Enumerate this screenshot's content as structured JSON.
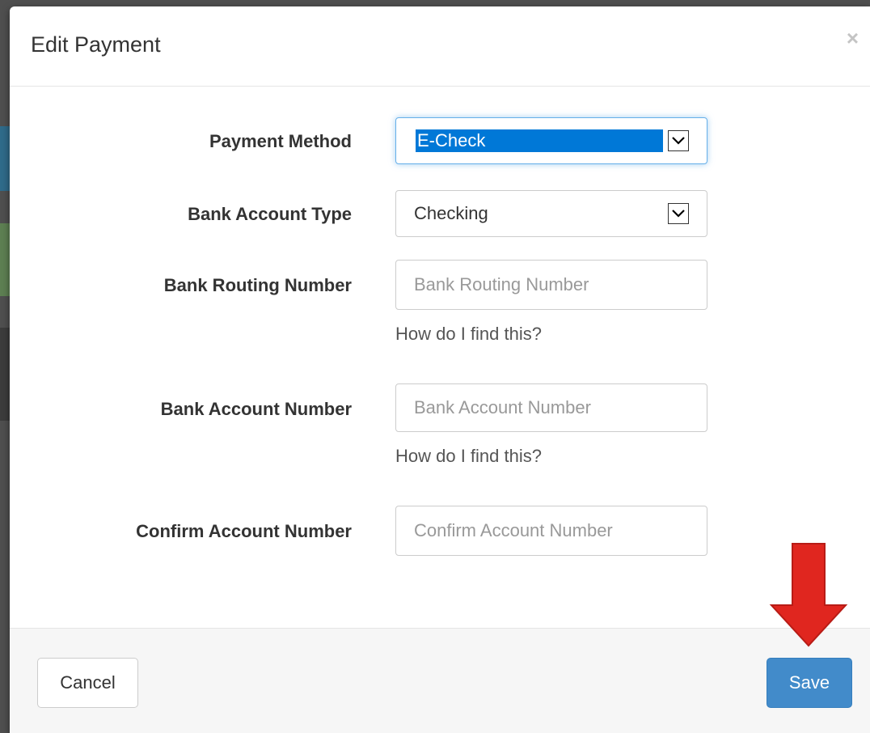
{
  "modal": {
    "title": "Edit Payment",
    "close_symbol": "×"
  },
  "form": {
    "payment_method": {
      "label": "Payment Method",
      "value": "E-Check"
    },
    "account_type": {
      "label": "Bank Account Type",
      "value": "Checking"
    },
    "routing_number": {
      "label": "Bank Routing Number",
      "placeholder": "Bank Routing Number",
      "help": "How do I find this?"
    },
    "account_number": {
      "label": "Bank Account Number",
      "placeholder": "Bank Account Number",
      "help": "How do I find this?"
    },
    "confirm_account": {
      "label": "Confirm Account Number",
      "placeholder": "Confirm Account Number"
    }
  },
  "footer": {
    "cancel_label": "Cancel",
    "save_label": "Save"
  },
  "annotation": {
    "icon": "down-arrow-icon",
    "color": "#e0261f"
  }
}
